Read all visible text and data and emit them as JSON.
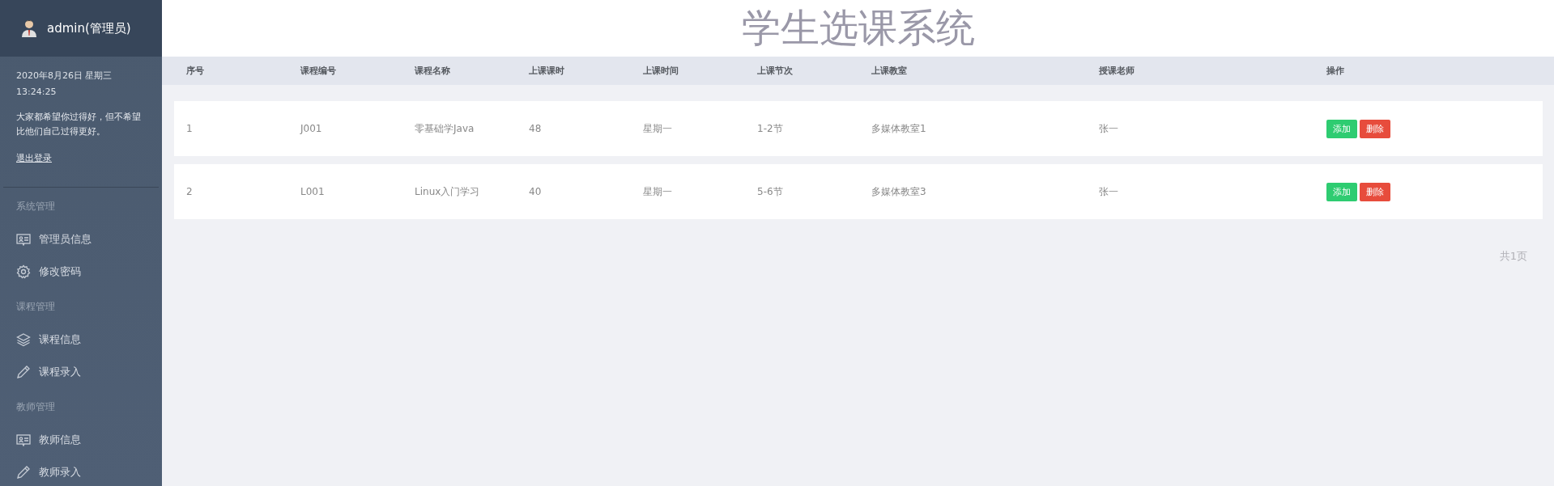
{
  "sidebar": {
    "user": "admin(管理员)",
    "date": "2020年8月26日 星期三",
    "time": "13:24:25",
    "motto": "大家都希望你过得好，但不希望比他们自己过得更好。",
    "logout": "退出登录",
    "sections": [
      {
        "title": "系统管理",
        "items": [
          {
            "label": "管理员信息",
            "kind": "card"
          },
          {
            "label": "修改密码",
            "kind": "gear"
          }
        ]
      },
      {
        "title": "课程管理",
        "items": [
          {
            "label": "课程信息",
            "kind": "layers"
          },
          {
            "label": "课程录入",
            "kind": "pencil"
          }
        ]
      },
      {
        "title": "教师管理",
        "items": [
          {
            "label": "教师信息",
            "kind": "card"
          },
          {
            "label": "教师录入",
            "kind": "pencil"
          }
        ]
      }
    ]
  },
  "title": "学生选课系统",
  "table": {
    "columns": [
      "序号",
      "课程编号",
      "课程名称",
      "上课课时",
      "上课时间",
      "上课节次",
      "上课教室",
      "授课老师",
      "操作"
    ],
    "rows": [
      {
        "cells": [
          "1",
          "J001",
          "零基础学Java",
          "48",
          "星期一",
          "1-2节",
          "多媒体教室1",
          "张一"
        ],
        "actions": [
          "添加",
          "删除"
        ]
      },
      {
        "cells": [
          "2",
          "L001",
          "Linux入门学习",
          "40",
          "星期一",
          "5-6节",
          "多媒体教室3",
          "张一"
        ],
        "actions": [
          "添加",
          "删除"
        ]
      }
    ]
  },
  "pagination": "共1页"
}
